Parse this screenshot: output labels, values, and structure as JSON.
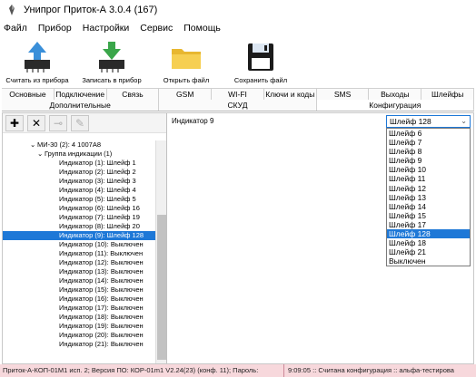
{
  "window": {
    "title": "Унипрог Приток-А  3.0.4 (167)"
  },
  "menu": [
    "Файл",
    "Прибор",
    "Настройки",
    "Сервис",
    "Помощь"
  ],
  "toolbar": {
    "read_label": "Считать из прибора",
    "write_label": "Записать в прибор",
    "open_label": "Открыть файл",
    "save_label": "Сохранить файл"
  },
  "tabs_row1": [
    "Основные",
    "Подключение",
    "Связь",
    "GSM",
    "WI-FI",
    "Ключи и коды",
    "SMS",
    "Выходы",
    "Шлейфы"
  ],
  "tabs_row2": [
    "Дополнительные",
    "СКУД",
    "Конфигурация"
  ],
  "active_tab": "Конфигурация",
  "tree": {
    "rows": [
      "МИ-30 (2): 4 1007A8",
      "Группа индикации (1)",
      "Индикатор (1): Шлейф 1",
      "Индикатор (2): Шлейф 2",
      "Индикатор (3): Шлейф 3",
      "Индикатор (4): Шлейф 4",
      "Индикатор (5): Шлейф 5",
      "Индикатор (6): Шлейф 16",
      "Индикатор (7): Шлейф 19",
      "Индикатор (8): Шлейф 20",
      "Индикатор (9): Шлейф 128",
      "Индикатор (10): Выключен",
      "Индикатор (11): Выключен",
      "Индикатор (12): Выключен",
      "Индикатор (13): Выключен",
      "Индикатор (14): Выключен",
      "Индикатор (15): Выключен",
      "Индикатор (16): Выключен",
      "Индикатор (17): Выключен",
      "Индикатор (18): Выключен",
      "Индикатор (19): Выключен",
      "Индикатор (20): Выключен",
      "Индикатор (21): Выключен"
    ],
    "selected": "Индикатор (9): Шлейф 128"
  },
  "field": {
    "label": "Индикатор 9",
    "value": "Шлейф 128",
    "options": [
      "Шлейф 6",
      "Шлейф 7",
      "Шлейф 8",
      "Шлейф 9",
      "Шлейф 10",
      "Шлейф 11",
      "Шлейф 12",
      "Шлейф 13",
      "Шлейф 14",
      "Шлейф 15",
      "Шлейф 17",
      "Шлейф 128",
      "Шлейф 18",
      "Шлейф 21",
      "Выключен"
    ]
  },
  "status": {
    "left": "Приток-А-КОП-01М1 исп. 2; Версия ПО: КОР-01m1 V2.24(23) (конф. 11); Пароль:",
    "right": "9:09:05 :: Считана конфигурация :: альфа-тестирова"
  },
  "colors": {
    "accent": "#1e78d7",
    "status_bg": "#f7d8dc"
  }
}
